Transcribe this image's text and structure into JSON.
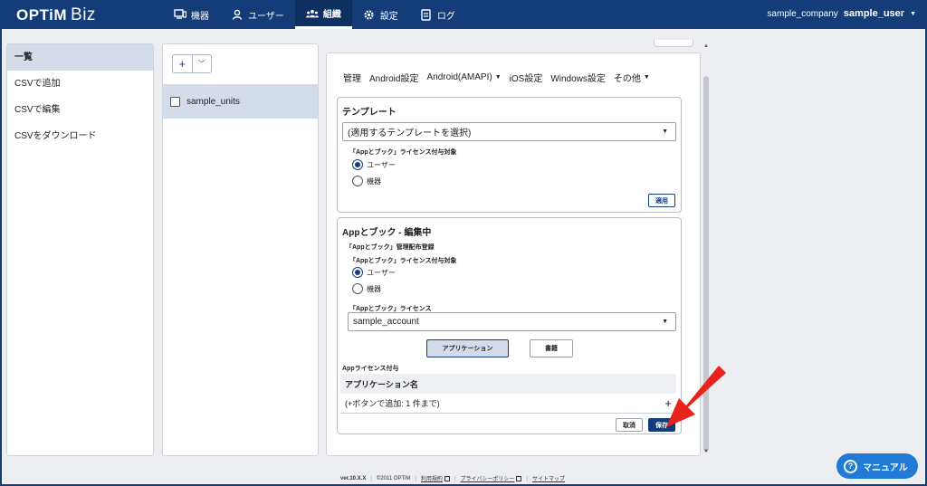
{
  "header": {
    "logo_main": "OPTiM",
    "logo_sub": "Biz",
    "nav": [
      {
        "label": "機器",
        "icon": "device-icon"
      },
      {
        "label": "ユーザー",
        "icon": "user-icon"
      },
      {
        "label": "組織",
        "icon": "organization-icon",
        "active": true
      },
      {
        "label": "設定",
        "icon": "gear-icon"
      },
      {
        "label": "ログ",
        "icon": "log-icon"
      }
    ],
    "company": "sample_company",
    "user": "sample_user"
  },
  "sidebar": {
    "items": [
      {
        "label": "一覧",
        "active": true
      },
      {
        "label": "CSVで追加"
      },
      {
        "label": "CSVで編集"
      },
      {
        "label": "CSVをダウンロード"
      }
    ]
  },
  "units": {
    "add_label": "+",
    "dropdown_label": "⌄",
    "items": [
      {
        "label": "sample_units",
        "checked": false
      }
    ]
  },
  "tabs": [
    {
      "label": "管理"
    },
    {
      "label": "Android設定"
    },
    {
      "label": "Android(AMAPI)",
      "has_dropdown": true
    },
    {
      "label": "iOS設定"
    },
    {
      "label": "Windows設定"
    },
    {
      "label": "その他",
      "has_dropdown": true
    }
  ],
  "template_card": {
    "title": "テンプレート",
    "select_value": "(適用するテンプレートを選択)",
    "license_target_label": "「Appとブック」ライセンス付与対象",
    "options": [
      {
        "label": "ユーザー",
        "selected": true
      },
      {
        "label": "機器",
        "selected": false
      }
    ],
    "apply_button": "適用"
  },
  "app_card": {
    "title": "Appとブック - 編集中",
    "distribution_label": "「Appとブック」管理配布登録",
    "license_target_label": "「Appとブック」ライセンス付与対象",
    "options": [
      {
        "label": "ユーザー",
        "selected": true
      },
      {
        "label": "機器",
        "selected": false
      }
    ],
    "license_label": "「Appとブック」ライセンス",
    "license_value": "sample_account",
    "type_buttons": [
      {
        "label": "アプリケーション",
        "selected": true
      },
      {
        "label": "書籍",
        "selected": false
      }
    ],
    "app_license_label": "Appライセンス付与",
    "table_header": "アプリケーション名",
    "table_placeholder": "(+ボタンで追加: 1 件まで)",
    "cancel_button": "取消",
    "save_button": "保存"
  },
  "footer": {
    "version": "ver.10.X.X",
    "copyright": "©2011 OPTiM",
    "terms": "利用規約",
    "privacy": "プライバシーポリシー",
    "sitemap": "サイトマップ"
  },
  "manual_button": "マニュアル",
  "colors": {
    "brand": "#143c78",
    "accent": "#1f7bd6",
    "highlight": "#d3dce8",
    "annotation_arrow": "#e8231e"
  }
}
